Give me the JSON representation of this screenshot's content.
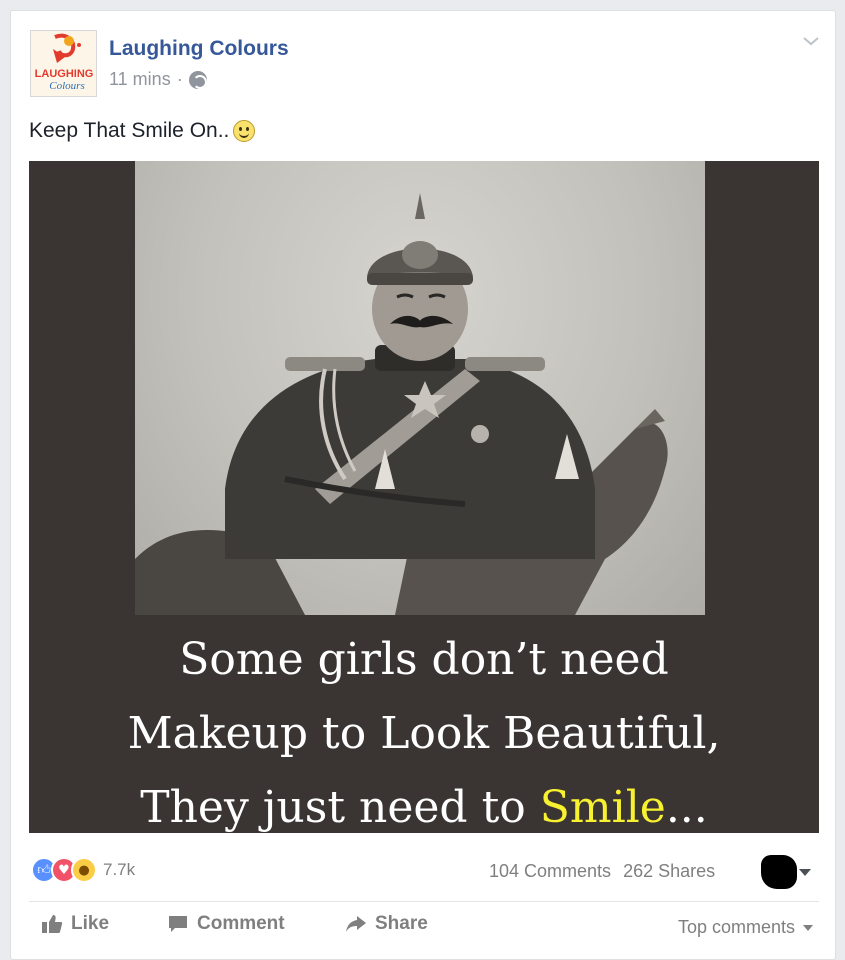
{
  "post": {
    "page_name": "Laughing Colours",
    "time": "11 mins",
    "separator": "·",
    "text": "Keep That Smile On..",
    "avatar_logo_text": "LAUGHING Colours"
  },
  "media": {
    "caption_line1": "Some girls don’t need",
    "caption_line2": "Makeup to Look Beautiful,",
    "caption_line3_pre": "They just need to ",
    "caption_line3_highlight": "Smile",
    "caption_line3_post": "...",
    "highlight_color": "#f7f130"
  },
  "engagement": {
    "reactions": [
      "like-reaction",
      "love-reaction",
      "wow-reaction"
    ],
    "reaction_count": "7.7k",
    "comments": "104 Comments",
    "shares": "262 Shares"
  },
  "actions": {
    "like": "Like",
    "comment": "Comment",
    "share": "Share",
    "sort": "Top comments"
  },
  "colors": {
    "page_name": "#365899",
    "media_background": "#3a3433",
    "like_blue": "#5890ff",
    "love_red": "#f25268",
    "wow_yellow": "#fbcd46"
  }
}
